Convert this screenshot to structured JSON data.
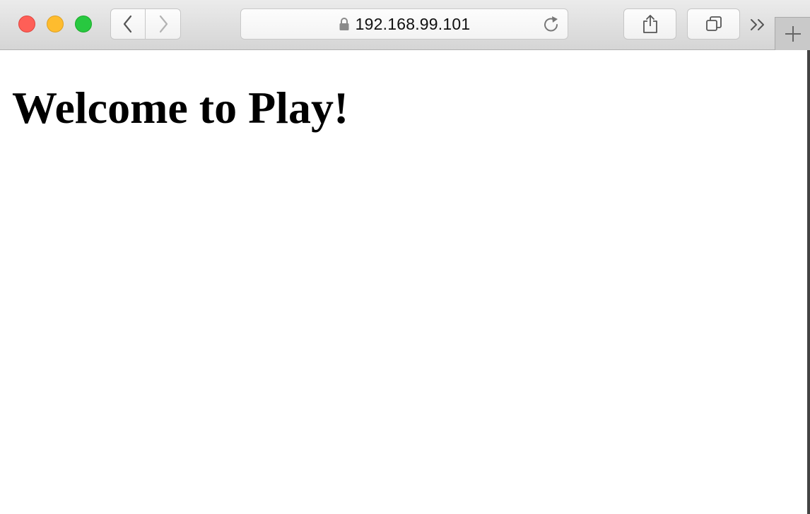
{
  "toolbar": {
    "url": "192.168.99.101",
    "buttons": {
      "back_icon": "chevron-left-icon",
      "forward_icon": "chevron-right-icon",
      "share_icon": "share-icon",
      "tabs_icon": "tab-overview-icon",
      "reload_icon": "reload-icon",
      "lock_icon": "lock-icon",
      "overflow_icon": "double-chevron-right-icon",
      "new_tab_icon": "plus-icon"
    },
    "traffic_lights": {
      "close_color": "#fe5f57",
      "minimize_color": "#febc2e",
      "maximize_color": "#28c840"
    }
  },
  "page": {
    "heading": "Welcome to Play!"
  }
}
